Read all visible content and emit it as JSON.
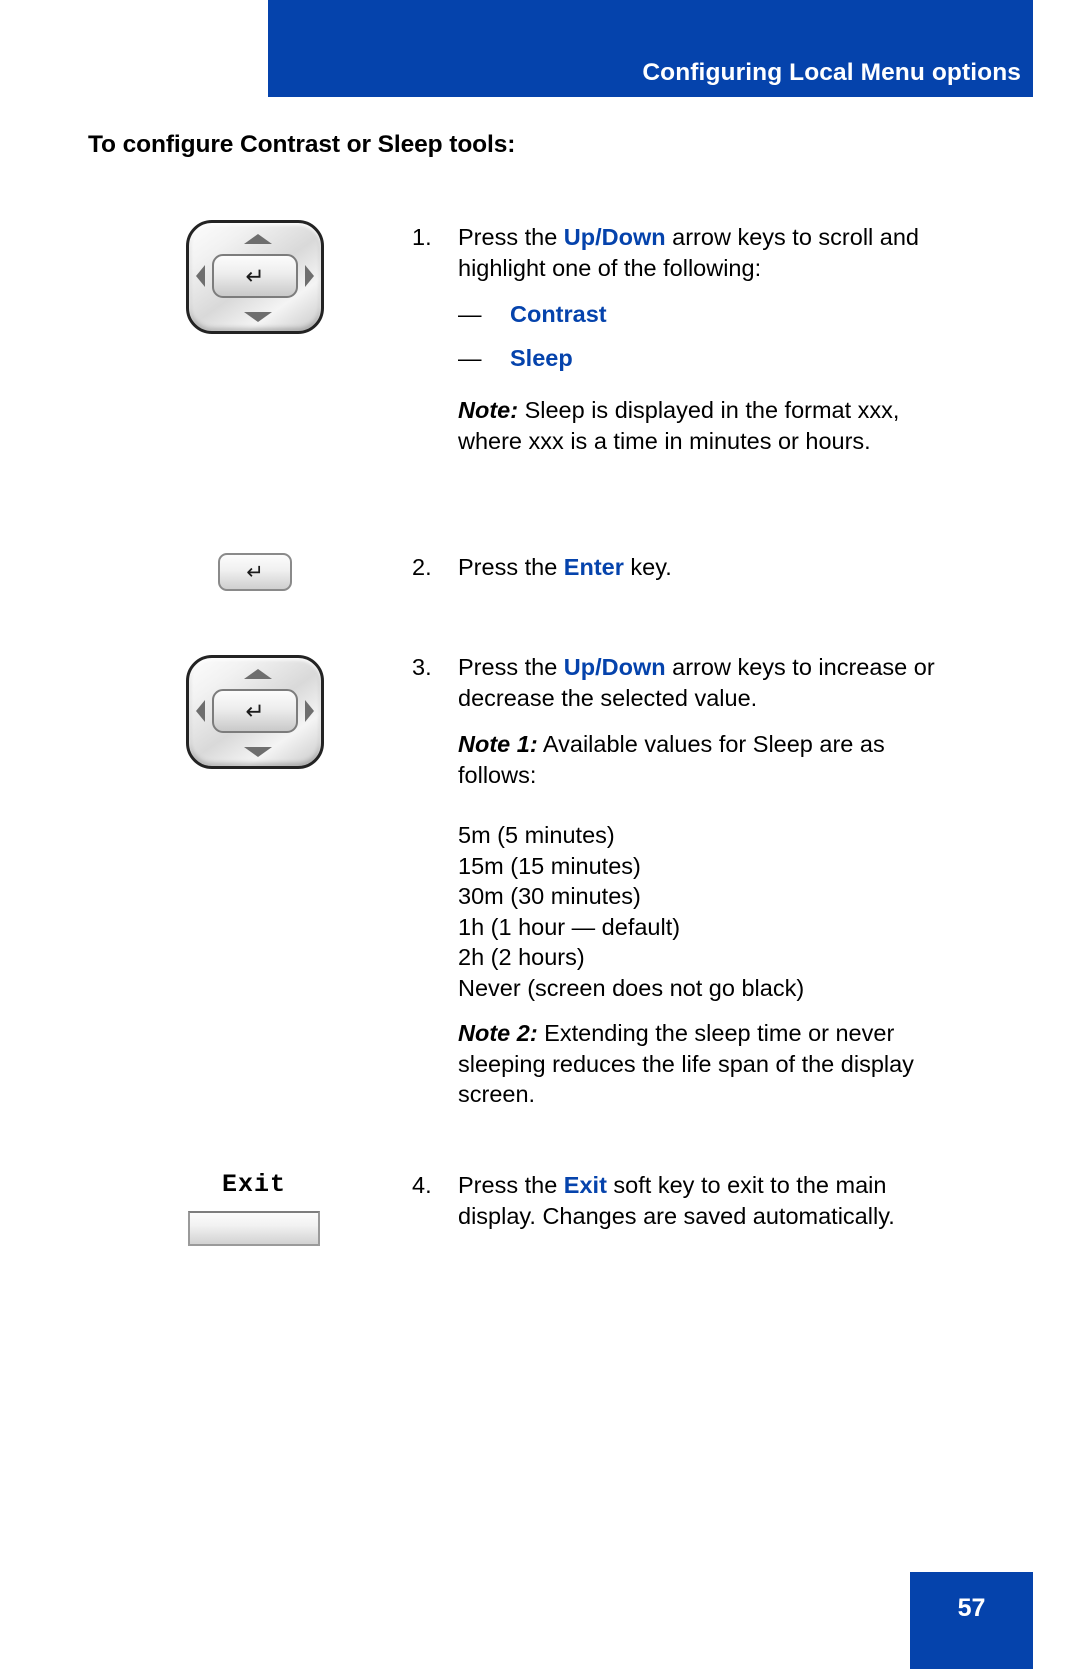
{
  "header": {
    "title": "Configuring Local Menu options",
    "band_color": "#0543ac"
  },
  "section": {
    "heading": "To configure Contrast or Sleep tools:"
  },
  "accent_color": "#0543ac",
  "steps": [
    {
      "number": "1.",
      "text_before": "Press the ",
      "key_label": "Up/Down",
      "text_after": " arrow keys to scroll and highlight one of the following:",
      "bullets": [
        {
          "dash": "—",
          "term": "Contrast"
        },
        {
          "dash": "—",
          "term": "Sleep"
        }
      ],
      "note_lead": "Note:",
      "note_text": " Sleep is displayed in the format xxx, where xxx is a time in minutes or hours.",
      "icon": "navigation-cluster-key"
    },
    {
      "number": "2.",
      "text_before": "Press the ",
      "key_label": "Enter",
      "text_after": " key.",
      "icon": "enter-key"
    },
    {
      "number": "3.",
      "text_before": "Press the ",
      "key_label": "Up/Down",
      "text_after": " arrow keys to increase or decrease the selected value.",
      "note1_lead": "Note 1:",
      "note1_text": " Available values for Sleep are as follows:",
      "values": [
        "5m (5 minutes)",
        "15m (15 minutes)",
        "30m (30 minutes)",
        "1h (1 hour — default)",
        "2h (2 hours)",
        "Never (screen does not go black)"
      ],
      "note2_lead": "Note 2:",
      "note2_text": " Extending the sleep time or never sleeping reduces the life span of the display screen.",
      "icon": "navigation-cluster-key"
    },
    {
      "number": "4.",
      "text_before": "Press the ",
      "key_label": "Exit",
      "text_after": " soft key to exit to the main display. Changes are saved automatically.",
      "icon": "exit-soft-key"
    }
  ],
  "keys": {
    "enter_glyph": "↵",
    "exit_softkey_label": "Exit"
  },
  "footer": {
    "page_number": "57"
  }
}
